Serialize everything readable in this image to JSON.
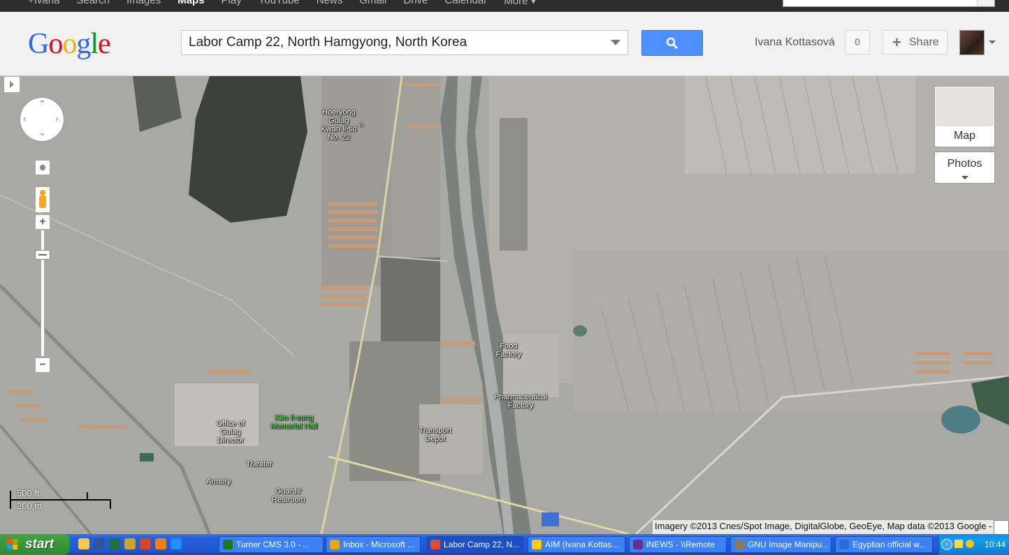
{
  "top_nav": {
    "items": [
      "+Ivana",
      "Search",
      "Images",
      "Maps",
      "Play",
      "YouTube",
      "News",
      "Gmail",
      "Drive",
      "Calendar",
      "More ▾"
    ],
    "active_index": 3
  },
  "header": {
    "logo": {
      "G": "G",
      "o1": "o",
      "o2": "o",
      "g": "g",
      "l": "l",
      "e": "e"
    },
    "search_value": "Labor Camp 22, North Hamgyong, North Korea",
    "user_name": "Ivana Kottasová",
    "notification_count": "0",
    "share_label": "Share"
  },
  "map": {
    "labels": [
      {
        "key": "hoeryong",
        "text": "Hoeryong\nGulag\nKwan-li-so\nNo. 22"
      },
      {
        "key": "food",
        "text": "Food\nFactory"
      },
      {
        "key": "pharma",
        "text": "Pharmaceutical\nFactory"
      },
      {
        "key": "transport",
        "text": "Transport\nDepot"
      },
      {
        "key": "kimilsung",
        "text": "Kim Il-sung\nMemorial Hall"
      },
      {
        "key": "office",
        "text": "Office of\nGulag Director"
      },
      {
        "key": "theater",
        "text": "Theater"
      },
      {
        "key": "armory",
        "text": "Armory"
      },
      {
        "key": "guards",
        "text": "Guards'\nRestroom"
      }
    ],
    "map_type_label": "Map",
    "photos_label": "Photos",
    "scale_ft": "500 ft",
    "scale_m": "200 m",
    "attribution": "Imagery ©2013 Cnes/Spot Image, DigitalGlobe, GeoEye, Map data ©2013 Google -"
  },
  "taskbar": {
    "start_label": "start",
    "buttons": [
      {
        "label": "Turner CMS 3.0 - ...",
        "icon_color": "#1c7a1c"
      },
      {
        "label": "Inbox - Microsoft ...",
        "icon_color": "#f0a30a"
      },
      {
        "label": "Labor Camp 22, N...",
        "icon_color": "#dd4b39"
      },
      {
        "label": "AIM (Ivana Kottas...",
        "icon_color": "#ffcc00"
      },
      {
        "label": "iNEWS - \\\\Remote",
        "icon_color": "#6a2c91"
      },
      {
        "label": "GNU Image Manipu...",
        "icon_color": "#8a7a5a"
      },
      {
        "label": "Egyptian official w...",
        "icon_color": "#2a6ed6"
      }
    ],
    "clock": "10:44"
  }
}
